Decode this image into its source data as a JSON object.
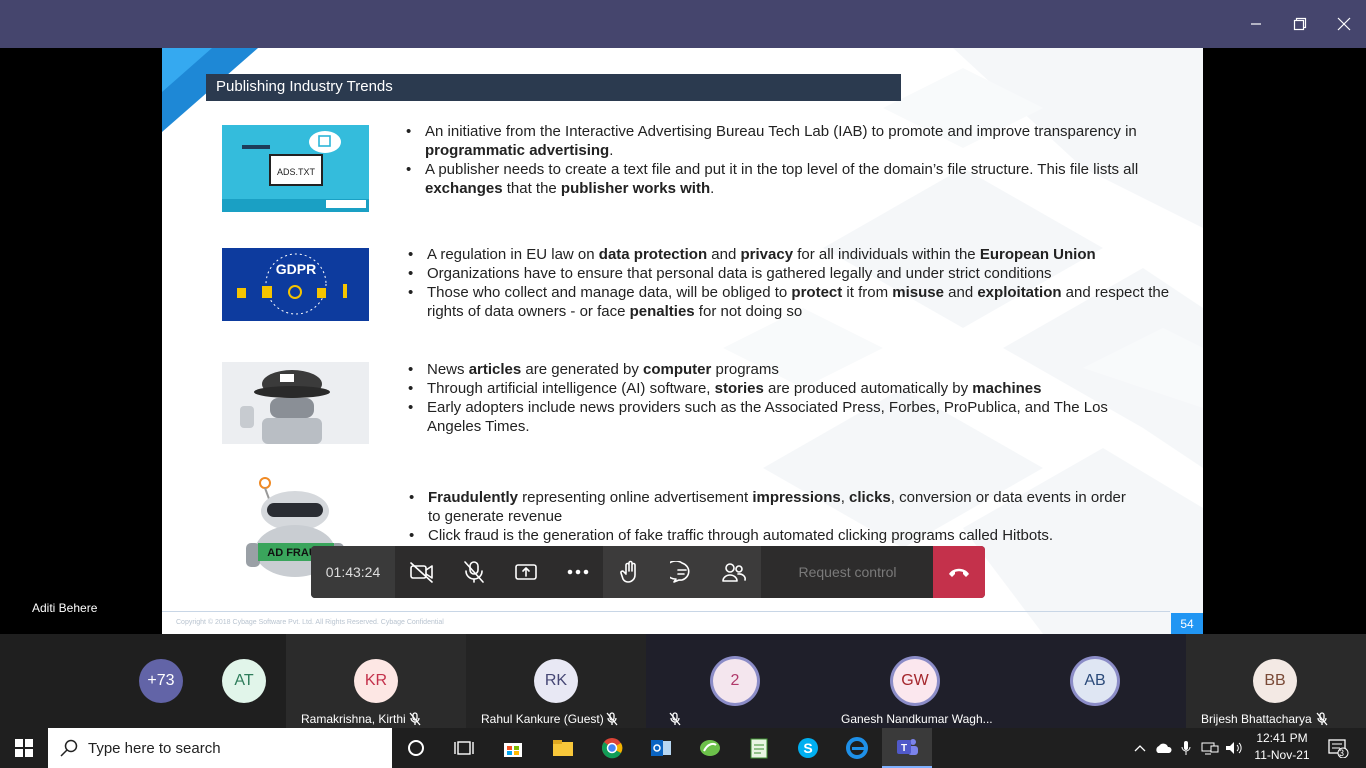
{
  "window": {
    "controls": [
      "minimize-icon",
      "restore-icon",
      "close-icon"
    ]
  },
  "slide": {
    "title": "Publishing Industry Trends",
    "page_number": "54",
    "copyright": "Copyright © 2018 Cybage Software Pvt. Ltd. All Rights Reserved. Cybage Confidential",
    "thumb_ads_label": "ADS.TXT",
    "thumb_gdpr_label": "GDPR",
    "thumb_adfraud_label": "AD FRAUD",
    "sections": [
      {
        "bullets": [
          {
            "segments": [
              {
                "t": "An initiative from the Interactive Advertising Bureau Tech Lab (IAB) to promote and improve transparency in "
              },
              {
                "t": "programmatic advertising",
                "b": true
              },
              {
                "t": "."
              }
            ]
          },
          {
            "segments": [
              {
                "t": "A publisher needs to create a text file and put it in the top level of the domain’s file structure. This file lists all "
              },
              {
                "t": "exchanges",
                "b": true
              },
              {
                "t": " that the "
              },
              {
                "t": "publisher works with",
                "b": true
              },
              {
                "t": "."
              }
            ]
          }
        ]
      },
      {
        "bullets": [
          {
            "segments": [
              {
                "t": "A regulation in EU law on "
              },
              {
                "t": "data protection",
                "b": true
              },
              {
                "t": " and "
              },
              {
                "t": "privacy",
                "b": true
              },
              {
                "t": " for all individuals within the "
              },
              {
                "t": "European Union",
                "b": true
              }
            ]
          },
          {
            "segments": [
              {
                "t": "Organizations have to ensure that personal data is gathered legally and under strict conditions"
              }
            ]
          },
          {
            "segments": [
              {
                "t": "Those who collect and manage data, will be obliged to "
              },
              {
                "t": "protect",
                "b": true
              },
              {
                "t": " it from "
              },
              {
                "t": "misuse",
                "b": true
              },
              {
                "t": " and "
              },
              {
                "t": "exploitation",
                "b": true
              },
              {
                "t": " and respect the rights of data owners - or face "
              },
              {
                "t": "penalties",
                "b": true
              },
              {
                "t": " for not doing so"
              }
            ]
          }
        ]
      },
      {
        "bullets": [
          {
            "segments": [
              {
                "t": "News "
              },
              {
                "t": "articles",
                "b": true
              },
              {
                "t": " are generated by "
              },
              {
                "t": "computer",
                "b": true
              },
              {
                "t": " programs"
              }
            ]
          },
          {
            "segments": [
              {
                "t": "Through artificial intelligence (AI) software, "
              },
              {
                "t": "stories",
                "b": true
              },
              {
                "t": " are produced automatically by "
              },
              {
                "t": "machines",
                "b": true
              }
            ]
          },
          {
            "segments": [
              {
                "t": "Early adopters include news providers such as the Associated Press, Forbes, ProPublica, and The Los Angeles Times."
              }
            ]
          }
        ]
      },
      {
        "bullets": [
          {
            "segments": [
              {
                "t": "Fraudulently",
                "b": true
              },
              {
                "t": " representing online advertisement "
              },
              {
                "t": "impressions",
                "b": true
              },
              {
                "t": ", "
              },
              {
                "t": "clicks",
                "b": true
              },
              {
                "t": ", conversion or data events in order to generate revenue"
              }
            ]
          },
          {
            "segments": [
              {
                "t": "Click fraud is the generation of fake traffic through automated clicking programs called Hitbots."
              }
            ]
          }
        ]
      }
    ]
  },
  "presenter": {
    "name": "Aditi Behere"
  },
  "meeting_controls": {
    "timer": "01:43:24",
    "request_control": "Request control",
    "icons": [
      "camera-off-icon",
      "mic-off-icon",
      "share-screen-icon",
      "more-icon",
      "raise-hand-icon",
      "chat-icon",
      "participants-icon",
      "hang-up-icon"
    ],
    "hangup_color": "#c4314b"
  },
  "participants": [
    {
      "initials": "+73",
      "name": "",
      "color": "#6264a7",
      "text_color": "#ffffff"
    },
    {
      "initials": "AT",
      "name": "",
      "color": "#e1f5ea",
      "text_color": "#2e7d5b"
    },
    {
      "initials": "KR",
      "name": "Ramakrishna, Kirthi",
      "color": "#fde7e4",
      "text_color": "#c4314b"
    },
    {
      "initials": "RK",
      "name": "Rahul Kankure (Guest)",
      "color": "#e8e8f4",
      "text_color": "#464775"
    },
    {
      "initials": "2",
      "name": "",
      "color": "#f4e6ee",
      "text_color": "#b03a6b"
    },
    {
      "initials": "GW",
      "name": "Ganesh Nandkumar Wagh...",
      "color": "#fbe7ee",
      "text_color": "#a4262c"
    },
    {
      "initials": "AB",
      "name": "",
      "color": "#dfe6f3",
      "text_color": "#2b4a7a"
    },
    {
      "initials": "BB",
      "name": "Brijesh Bhattacharya",
      "color": "#f3e9e4",
      "text_color": "#7a4a37"
    }
  ],
  "taskbar": {
    "search_placeholder": "Type here to search",
    "time": "12:41 PM",
    "date": "11-Nov-21",
    "notification_count": "3",
    "apps": [
      "start-icon",
      "cortana-icon",
      "task-view-icon",
      "store-icon",
      "file-explorer-icon",
      "chrome-icon",
      "outlook-icon",
      "green-app-icon",
      "notepad-icon",
      "skype-icon",
      "edge-icon",
      "teams-icon"
    ]
  }
}
